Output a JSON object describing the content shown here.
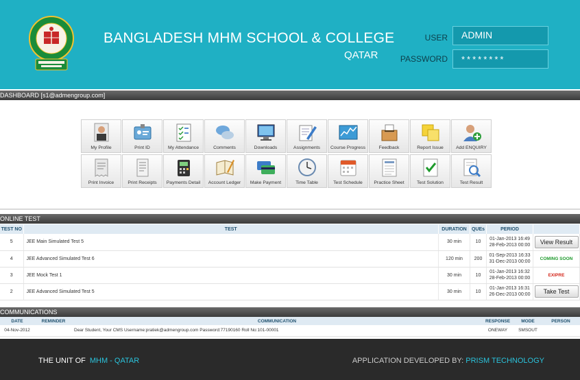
{
  "header": {
    "title": "BANGLADESH MHM SCHOOL & COLLEGE",
    "subtitle": "QATAR",
    "user_label": "USER",
    "user_value": "ADMIN",
    "password_label": "PASSWORD",
    "password_value": "********"
  },
  "dashboard": {
    "bar_label": "DASHBOARD [s1@admengroup.com]",
    "tiles_row1": [
      {
        "label": "My Profile",
        "icon": "profile-photo-icon"
      },
      {
        "label": "Print ID",
        "icon": "id-card-icon"
      },
      {
        "label": "My Attendance",
        "icon": "attendance-sheet-icon"
      },
      {
        "label": "Comments",
        "icon": "chat-bubbles-icon"
      },
      {
        "label": "Downloads",
        "icon": "monitor-download-icon"
      },
      {
        "label": "Assignments",
        "icon": "pencil-paper-icon"
      },
      {
        "label": "Course Progress",
        "icon": "chart-progress-icon"
      },
      {
        "label": "Feedback",
        "icon": "ballot-box-icon"
      },
      {
        "label": "Report Issue",
        "icon": "sticky-notes-icon"
      },
      {
        "label": "Add ENQUIRY",
        "icon": "add-user-icon"
      }
    ],
    "tiles_row2": [
      {
        "label": "Print Invoice",
        "icon": "invoice-icon"
      },
      {
        "label": "Print Receipts",
        "icon": "receipt-icon"
      },
      {
        "label": "Payments Detail",
        "icon": "card-terminal-icon"
      },
      {
        "label": "Account Ledger",
        "icon": "ledger-book-icon"
      },
      {
        "label": "Make Payment",
        "icon": "credit-cards-icon"
      },
      {
        "label": "Time Table",
        "icon": "clock-icon"
      },
      {
        "label": "Test Schedule",
        "icon": "calendar-icon"
      },
      {
        "label": "Practice Sheet",
        "icon": "practice-sheet-icon"
      },
      {
        "label": "Test Solution",
        "icon": "checkmark-doc-icon"
      },
      {
        "label": "Test Result",
        "icon": "magnifier-report-icon"
      }
    ]
  },
  "online_test": {
    "bar_label": "ONLINE TEST",
    "headers": {
      "no": "TEST NO",
      "test": "TEST",
      "duration": "DURATION",
      "ques": "QUEs",
      "period": "PERIOD"
    },
    "rows": [
      {
        "no": "5",
        "test": "JEE Main Simulated Test 5",
        "duration": "30 min",
        "ques": "10",
        "period_start": "01-Jan-2013 16:49",
        "period_end": "28-Feb-2013 00:00",
        "action": "View Result"
      },
      {
        "no": "4",
        "test": "JEE Advanced Simulated Test 6",
        "duration": "120 min",
        "ques": "200",
        "period_start": "01-Sep-2013 16:33",
        "period_end": "31-Dec-2013 00:00",
        "status": "COMING SOON"
      },
      {
        "no": "3",
        "test": "JEE Mock Test 1",
        "duration": "30 min",
        "ques": "10",
        "period_start": "01-Jan-2013 16:32",
        "period_end": "28-Feb-2013 00:00",
        "status": "EXIPRE"
      },
      {
        "no": "2",
        "test": "JEE Advanced Simulated Test 5",
        "duration": "30 min",
        "ques": "10",
        "period_start": "01-Jan-2013 16:31",
        "period_end": "26-Dec-2013 00:00",
        "action": "Take Test"
      }
    ]
  },
  "communications": {
    "bar_label": "COMMUNICATIONS",
    "headers": {
      "date": "DATE",
      "reminder": "REMINDER",
      "communication": "COMMUNICATION",
      "response": "RESPONSE",
      "mode": "MODE",
      "person": "PERSON"
    },
    "rows": [
      {
        "date": "04-Nov-2012",
        "reminder": "",
        "communication": "Dear Student, Your CMS Username:pratiek@admengroup.com Password:77190160 Roll No:101-00001",
        "response": "ONEWAY",
        "mode": "SMSOUT",
        "person": ""
      }
    ]
  },
  "footer": {
    "left_prefix": "THE UNIT OF",
    "left_highlight": "MHM - QATAR",
    "right_prefix": "APPLICATION DEVELOPED BY:",
    "right_highlight": "PRISM TECHNOLOGY"
  },
  "colors": {
    "header_bg": "#1fb0c4",
    "accent": "#2bc3dc",
    "footer_bg": "#2a2a2a"
  }
}
